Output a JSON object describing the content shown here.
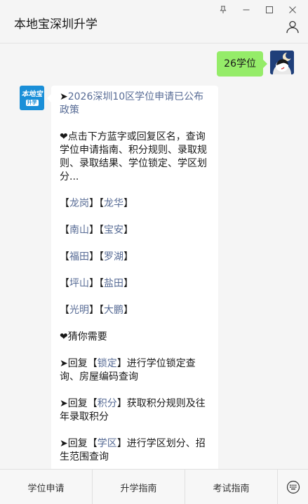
{
  "window": {
    "title": "本地宝深圳升学",
    "controls": [
      "pin-icon",
      "minimize-icon",
      "maximize-icon",
      "close-icon"
    ]
  },
  "chat": {
    "user_message": "26学位",
    "bot": {
      "avatar_text_top": "本地宝",
      "avatar_text_bottom": "升学",
      "headline_prefix": "➤",
      "headline_link": "2026深圳10区学位申请已公布政策",
      "intro": "❤点击下方蓝字或回复区名，查询学位申请指南、积分规则、录取规则、录取结果、学位锁定、学区划分...",
      "districts": [
        [
          "龙岗",
          "龙华"
        ],
        [
          "南山",
          "宝安"
        ],
        [
          "福田",
          "罗湖"
        ],
        [
          "坪山",
          "盐田"
        ],
        [
          "光明",
          "大鹏"
        ]
      ],
      "guess_title": "❤猜你需要",
      "tips": [
        {
          "prefix": "➤回复【",
          "keyword": "锁定",
          "suffix": "】进行学位锁定查询、房屋编码查询"
        },
        {
          "prefix": "➤回复【",
          "keyword": "积分",
          "suffix": "】获取积分规则及往年录取积分"
        },
        {
          "prefix": "➤回复【",
          "keyword": "学区",
          "suffix": "】进行学区划分、招生范围查询"
        }
      ]
    }
  },
  "menu": {
    "items": [
      "学位申请",
      "升学指南",
      "考试指南"
    ],
    "keyboard_icon": "keyboard-icon"
  },
  "colors": {
    "user_bubble": "#95ec69",
    "link": "#576b95",
    "background": "#f5f5f5"
  }
}
